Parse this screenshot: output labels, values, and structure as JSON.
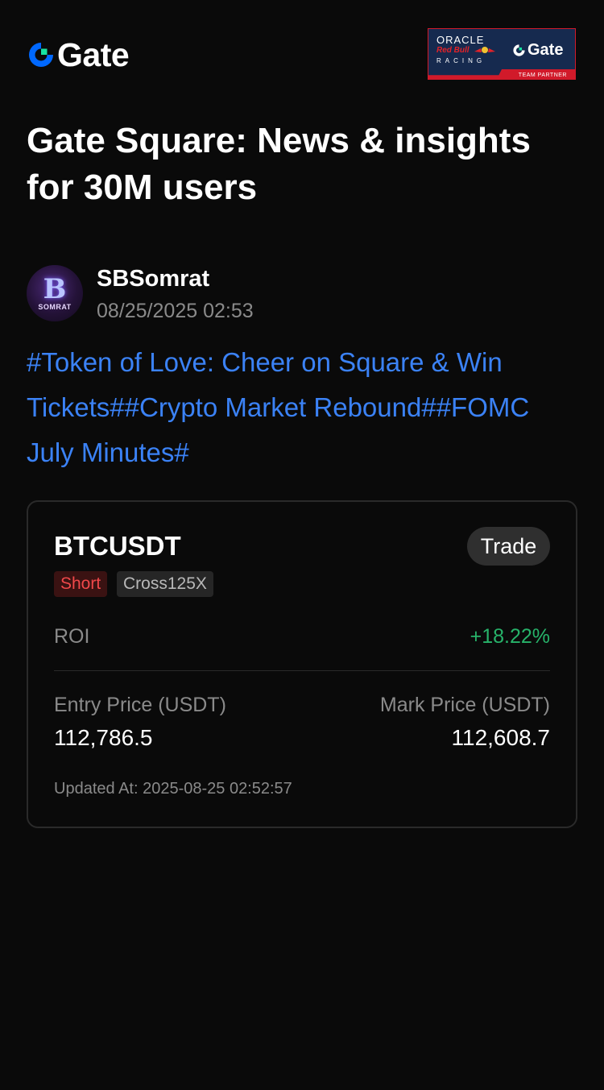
{
  "brand": {
    "logo_text": "Gate",
    "accent_blue": "#0068ff",
    "accent_green": "#17e3a2"
  },
  "partner_badge": {
    "oracle": "ORACLE",
    "red_bull": "Red Bull",
    "racing": "RACING",
    "gate_text": "Gate",
    "team_partner": "TEAM PARTNER",
    "colors": {
      "background": "#162a4f",
      "strip": "#d11a2a"
    }
  },
  "page": {
    "title": "Gate Square: News & insights for 30M users"
  },
  "post": {
    "author": {
      "name": "SBSomrat",
      "avatar_letter": "B",
      "avatar_label": "SOMRAT"
    },
    "timestamp": "08/25/2025 02:53",
    "hashtags": [
      "#Token of Love: Cheer on Square & Win Tickets#",
      "#Crypto Market Rebound#",
      "#FOMC July Minutes#"
    ]
  },
  "position_card": {
    "pair": "BTCUSDT",
    "trade_button": "Trade",
    "direction_tag": "Short",
    "leverage_tag": "Cross125X",
    "roi_label": "ROI",
    "roi_value": "+18.22%",
    "entry_price_label": "Entry Price (USDT)",
    "entry_price": "112,786.5",
    "mark_price_label": "Mark Price (USDT)",
    "mark_price": "112,608.7",
    "updated_at": "Updated At: 2025-08-25 02:52:57",
    "colors": {
      "positive": "#27b36a",
      "short": "#f0484a",
      "link": "#3b82f6"
    }
  }
}
